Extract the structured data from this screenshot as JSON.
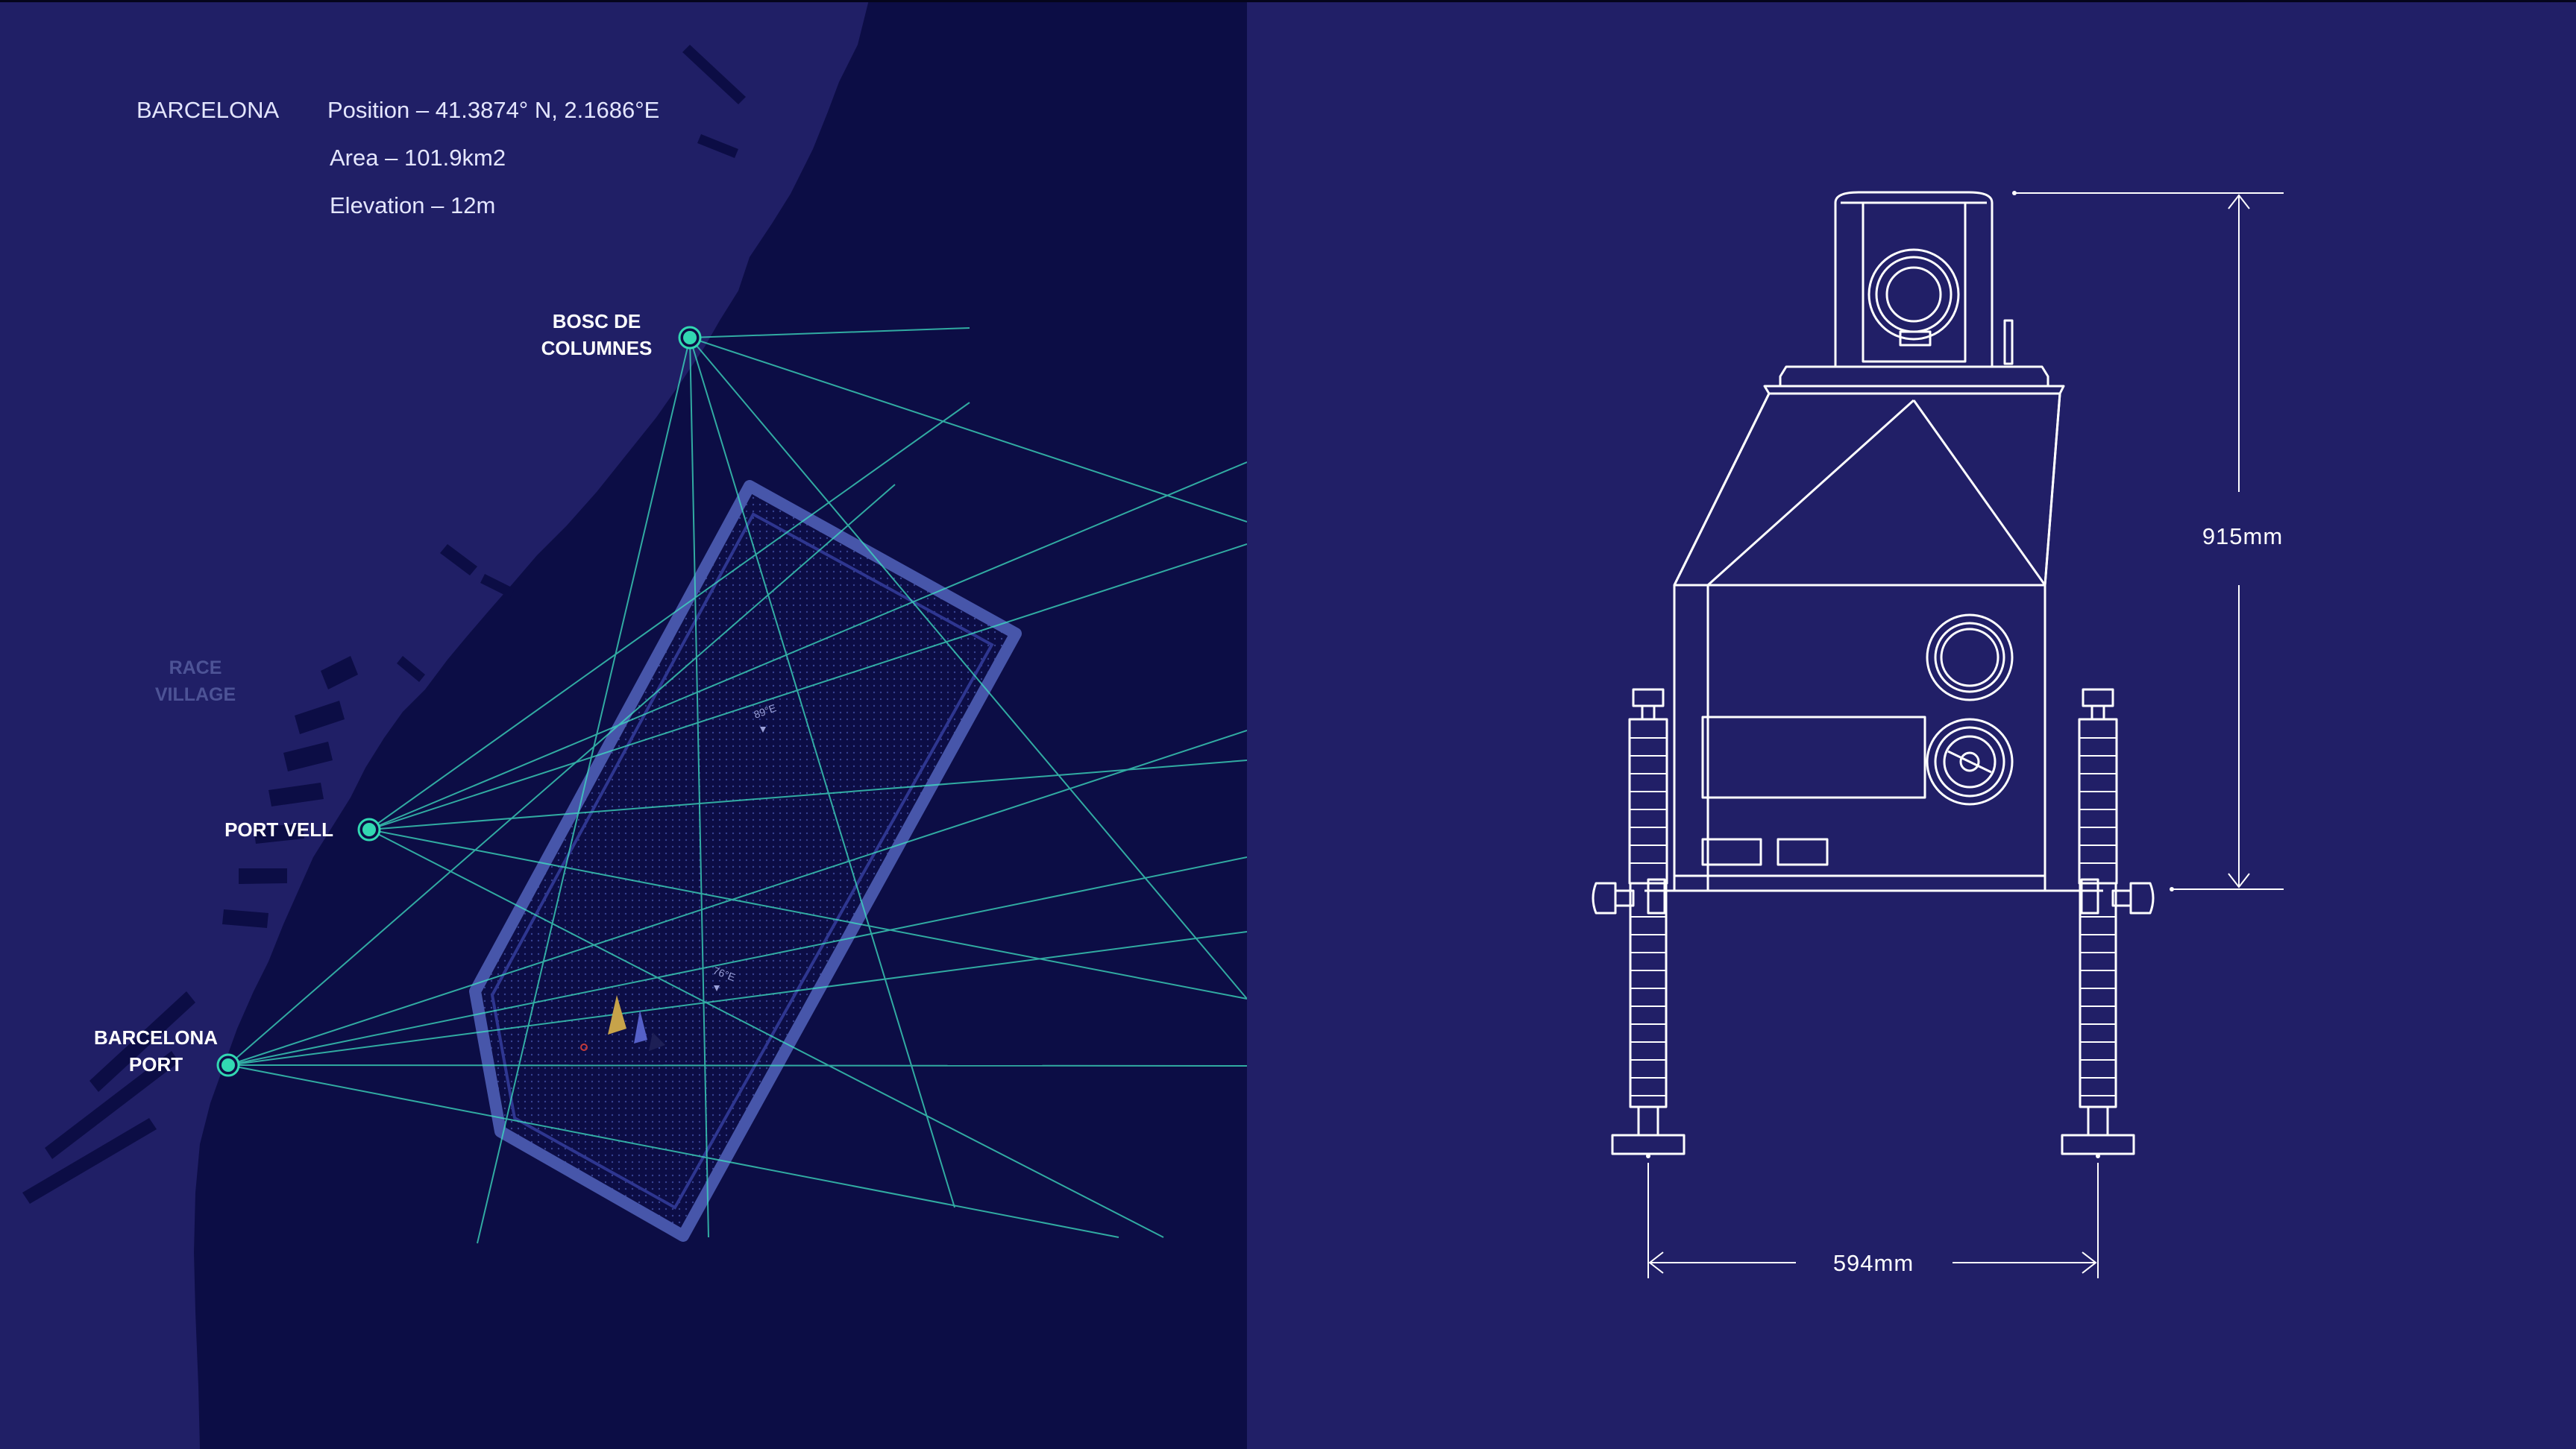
{
  "map": {
    "city": "BARCELONA",
    "position": "Position – 41.3874° N, 2.1686°E",
    "area": "Area – 101.9km2",
    "elevation": "Elevation – 12m",
    "district": [
      "RACE",
      "VILLAGE"
    ],
    "stations": [
      {
        "id": "bosc",
        "lines": [
          "BOSC DE",
          "COLUMNES"
        ]
      },
      {
        "id": "vell",
        "lines": [
          "PORT VELL"
        ]
      },
      {
        "id": "port",
        "lines": [
          "BARCELONA",
          "PORT"
        ]
      }
    ],
    "bearings": [
      "89°E",
      "76°E"
    ]
  },
  "drawing": {
    "height_label": "915mm",
    "width_label": "594mm"
  },
  "colors": {
    "map_background": "#0c0d45",
    "land": "#201f66",
    "drawing_background": "#211f67",
    "sightline": "#3ee0c2",
    "station": "#32d8b2",
    "zone": "#4b5ab0",
    "linework": "#ffffff"
  }
}
